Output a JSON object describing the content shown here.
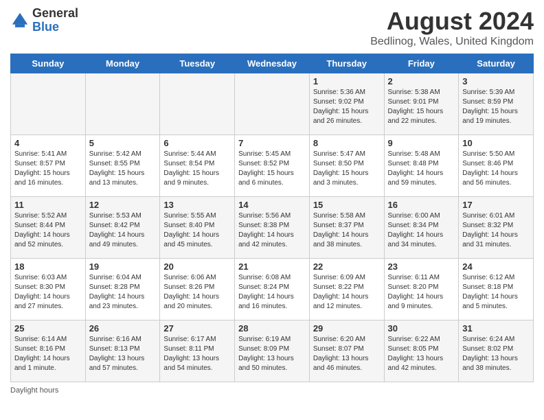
{
  "logo": {
    "text_general": "General",
    "text_blue": "Blue",
    "icon_alt": "GeneralBlue logo"
  },
  "header": {
    "title": "August 2024",
    "subtitle": "Bedlinog, Wales, United Kingdom"
  },
  "days_of_week": [
    "Sunday",
    "Monday",
    "Tuesday",
    "Wednesday",
    "Thursday",
    "Friday",
    "Saturday"
  ],
  "footer": {
    "daylight_label": "Daylight hours"
  },
  "weeks": [
    [
      {
        "day": "",
        "info": ""
      },
      {
        "day": "",
        "info": ""
      },
      {
        "day": "",
        "info": ""
      },
      {
        "day": "",
        "info": ""
      },
      {
        "day": "1",
        "info": "Sunrise: 5:36 AM\nSunset: 9:02 PM\nDaylight: 15 hours\nand 26 minutes."
      },
      {
        "day": "2",
        "info": "Sunrise: 5:38 AM\nSunset: 9:01 PM\nDaylight: 15 hours\nand 22 minutes."
      },
      {
        "day": "3",
        "info": "Sunrise: 5:39 AM\nSunset: 8:59 PM\nDaylight: 15 hours\nand 19 minutes."
      }
    ],
    [
      {
        "day": "4",
        "info": "Sunrise: 5:41 AM\nSunset: 8:57 PM\nDaylight: 15 hours\nand 16 minutes."
      },
      {
        "day": "5",
        "info": "Sunrise: 5:42 AM\nSunset: 8:55 PM\nDaylight: 15 hours\nand 13 minutes."
      },
      {
        "day": "6",
        "info": "Sunrise: 5:44 AM\nSunset: 8:54 PM\nDaylight: 15 hours\nand 9 minutes."
      },
      {
        "day": "7",
        "info": "Sunrise: 5:45 AM\nSunset: 8:52 PM\nDaylight: 15 hours\nand 6 minutes."
      },
      {
        "day": "8",
        "info": "Sunrise: 5:47 AM\nSunset: 8:50 PM\nDaylight: 15 hours\nand 3 minutes."
      },
      {
        "day": "9",
        "info": "Sunrise: 5:48 AM\nSunset: 8:48 PM\nDaylight: 14 hours\nand 59 minutes."
      },
      {
        "day": "10",
        "info": "Sunrise: 5:50 AM\nSunset: 8:46 PM\nDaylight: 14 hours\nand 56 minutes."
      }
    ],
    [
      {
        "day": "11",
        "info": "Sunrise: 5:52 AM\nSunset: 8:44 PM\nDaylight: 14 hours\nand 52 minutes."
      },
      {
        "day": "12",
        "info": "Sunrise: 5:53 AM\nSunset: 8:42 PM\nDaylight: 14 hours\nand 49 minutes."
      },
      {
        "day": "13",
        "info": "Sunrise: 5:55 AM\nSunset: 8:40 PM\nDaylight: 14 hours\nand 45 minutes."
      },
      {
        "day": "14",
        "info": "Sunrise: 5:56 AM\nSunset: 8:38 PM\nDaylight: 14 hours\nand 42 minutes."
      },
      {
        "day": "15",
        "info": "Sunrise: 5:58 AM\nSunset: 8:37 PM\nDaylight: 14 hours\nand 38 minutes."
      },
      {
        "day": "16",
        "info": "Sunrise: 6:00 AM\nSunset: 8:34 PM\nDaylight: 14 hours\nand 34 minutes."
      },
      {
        "day": "17",
        "info": "Sunrise: 6:01 AM\nSunset: 8:32 PM\nDaylight: 14 hours\nand 31 minutes."
      }
    ],
    [
      {
        "day": "18",
        "info": "Sunrise: 6:03 AM\nSunset: 8:30 PM\nDaylight: 14 hours\nand 27 minutes."
      },
      {
        "day": "19",
        "info": "Sunrise: 6:04 AM\nSunset: 8:28 PM\nDaylight: 14 hours\nand 23 minutes."
      },
      {
        "day": "20",
        "info": "Sunrise: 6:06 AM\nSunset: 8:26 PM\nDaylight: 14 hours\nand 20 minutes."
      },
      {
        "day": "21",
        "info": "Sunrise: 6:08 AM\nSunset: 8:24 PM\nDaylight: 14 hours\nand 16 minutes."
      },
      {
        "day": "22",
        "info": "Sunrise: 6:09 AM\nSunset: 8:22 PM\nDaylight: 14 hours\nand 12 minutes."
      },
      {
        "day": "23",
        "info": "Sunrise: 6:11 AM\nSunset: 8:20 PM\nDaylight: 14 hours\nand 9 minutes."
      },
      {
        "day": "24",
        "info": "Sunrise: 6:12 AM\nSunset: 8:18 PM\nDaylight: 14 hours\nand 5 minutes."
      }
    ],
    [
      {
        "day": "25",
        "info": "Sunrise: 6:14 AM\nSunset: 8:16 PM\nDaylight: 14 hours\nand 1 minute."
      },
      {
        "day": "26",
        "info": "Sunrise: 6:16 AM\nSunset: 8:13 PM\nDaylight: 13 hours\nand 57 minutes."
      },
      {
        "day": "27",
        "info": "Sunrise: 6:17 AM\nSunset: 8:11 PM\nDaylight: 13 hours\nand 54 minutes."
      },
      {
        "day": "28",
        "info": "Sunrise: 6:19 AM\nSunset: 8:09 PM\nDaylight: 13 hours\nand 50 minutes."
      },
      {
        "day": "29",
        "info": "Sunrise: 6:20 AM\nSunset: 8:07 PM\nDaylight: 13 hours\nand 46 minutes."
      },
      {
        "day": "30",
        "info": "Sunrise: 6:22 AM\nSunset: 8:05 PM\nDaylight: 13 hours\nand 42 minutes."
      },
      {
        "day": "31",
        "info": "Sunrise: 6:24 AM\nSunset: 8:02 PM\nDaylight: 13 hours\nand 38 minutes."
      }
    ]
  ]
}
